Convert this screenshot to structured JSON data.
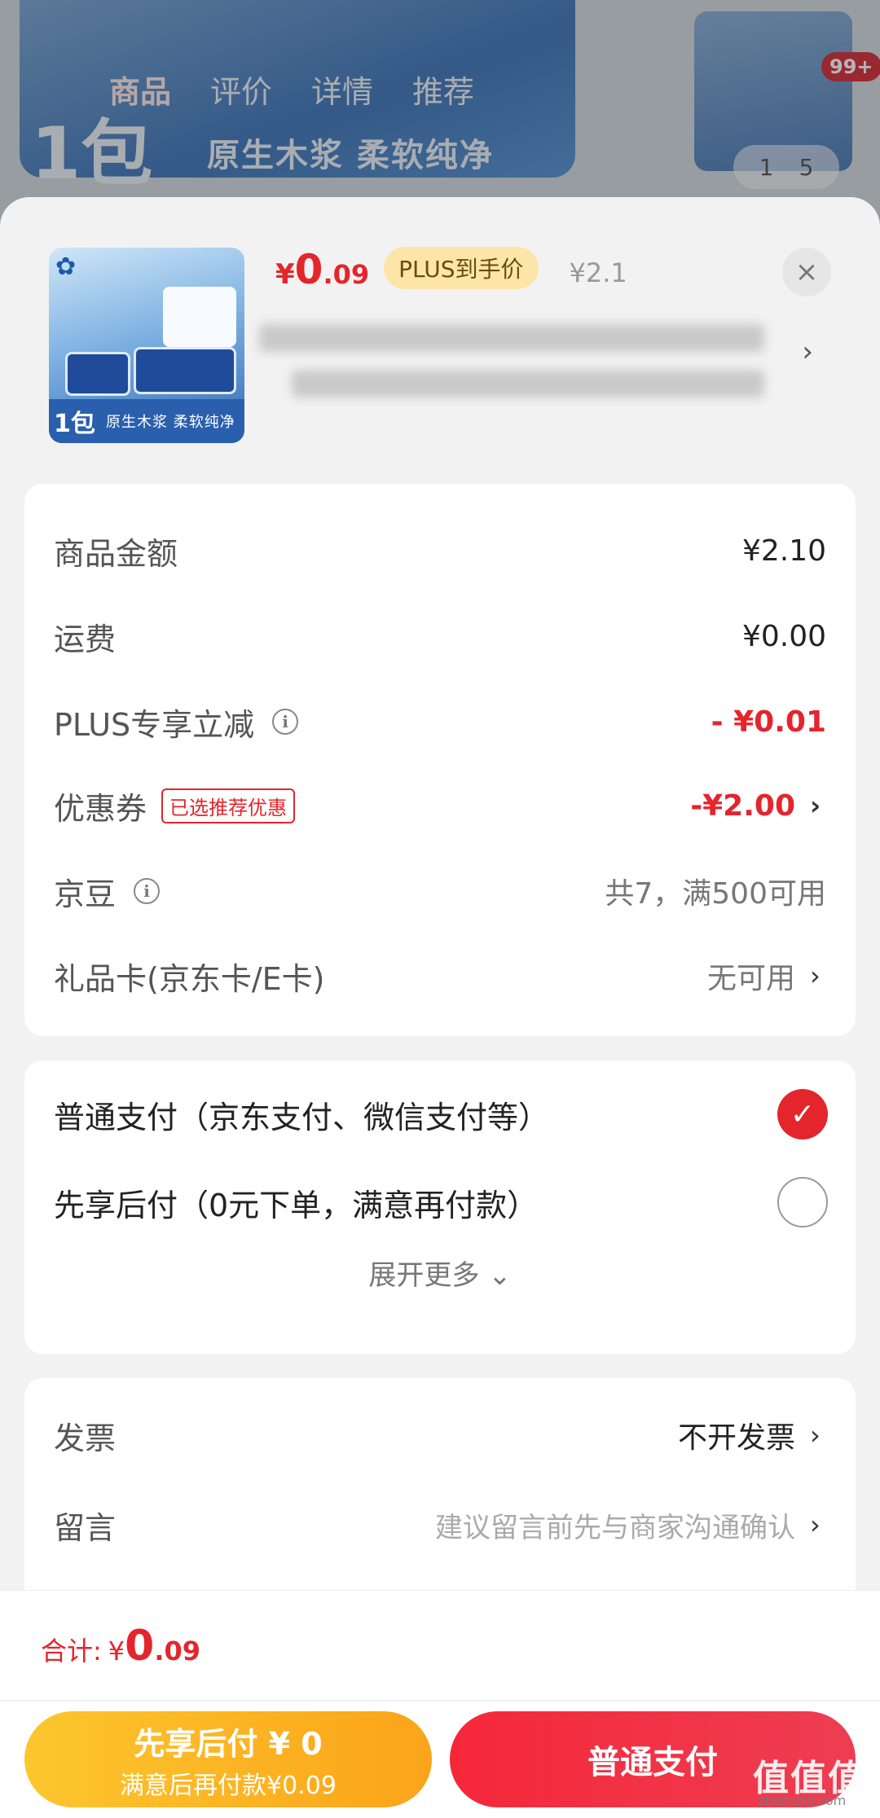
{
  "background": {
    "tabs": [
      "商品",
      "评价",
      "详情",
      "推荐"
    ],
    "banner_pack": "1包",
    "banner_slogan": "原生木浆 柔软纯净",
    "cart_badge": "99+",
    "gallery_counter": {
      "current": "1",
      "total": "5"
    }
  },
  "product": {
    "price_symbol": "¥",
    "price_int": "0",
    "price_dec": ".09",
    "plus_tag": "PLUS到手价",
    "original_price": "¥2.1",
    "close_label": "×",
    "image_pack": "1包",
    "image_slogan": "原生木浆 柔软纯净"
  },
  "fees": {
    "goods_amount": {
      "label": "商品金额",
      "value": "¥2.10"
    },
    "shipping": {
      "label": "运费",
      "value": "¥0.00"
    },
    "plus_discount": {
      "label": "PLUS专享立减",
      "value": "- ¥0.01"
    },
    "coupon": {
      "label": "优惠券",
      "badge": "已选推荐优惠",
      "value": "-¥2.00"
    },
    "jingdou": {
      "label": "京豆",
      "value": "共7，满500可用"
    },
    "gift_card": {
      "label": "礼品卡(京东卡/E卡)",
      "value": "无可用"
    }
  },
  "payment": {
    "normal": {
      "label": "普通支付（京东支付、微信支付等）",
      "selected": true
    },
    "later": {
      "label": "先享后付（0元下单，满意再付款）",
      "selected": false
    },
    "expand_label": "展开更多"
  },
  "misc": {
    "invoice": {
      "label": "发票",
      "value": "不开发票"
    },
    "message": {
      "label": "留言",
      "placeholder": "建议留言前先与商家沟通确认"
    }
  },
  "footer": {
    "total_label": "合计:",
    "total_symbol": "¥",
    "total_int": "0",
    "total_dec": ".09",
    "pay_later_title": "先享后付 ¥ 0",
    "pay_later_sub": "满意后再付款¥0.09",
    "pay_normal": "普通支付",
    "watermark": "值值值",
    "watermark_url": "zhizhizhi.com"
  },
  "colors": {
    "accent_red": "#e4252c",
    "plus_gold": "#fbe6a8",
    "pay_later_yellow": "#fcc62e"
  }
}
